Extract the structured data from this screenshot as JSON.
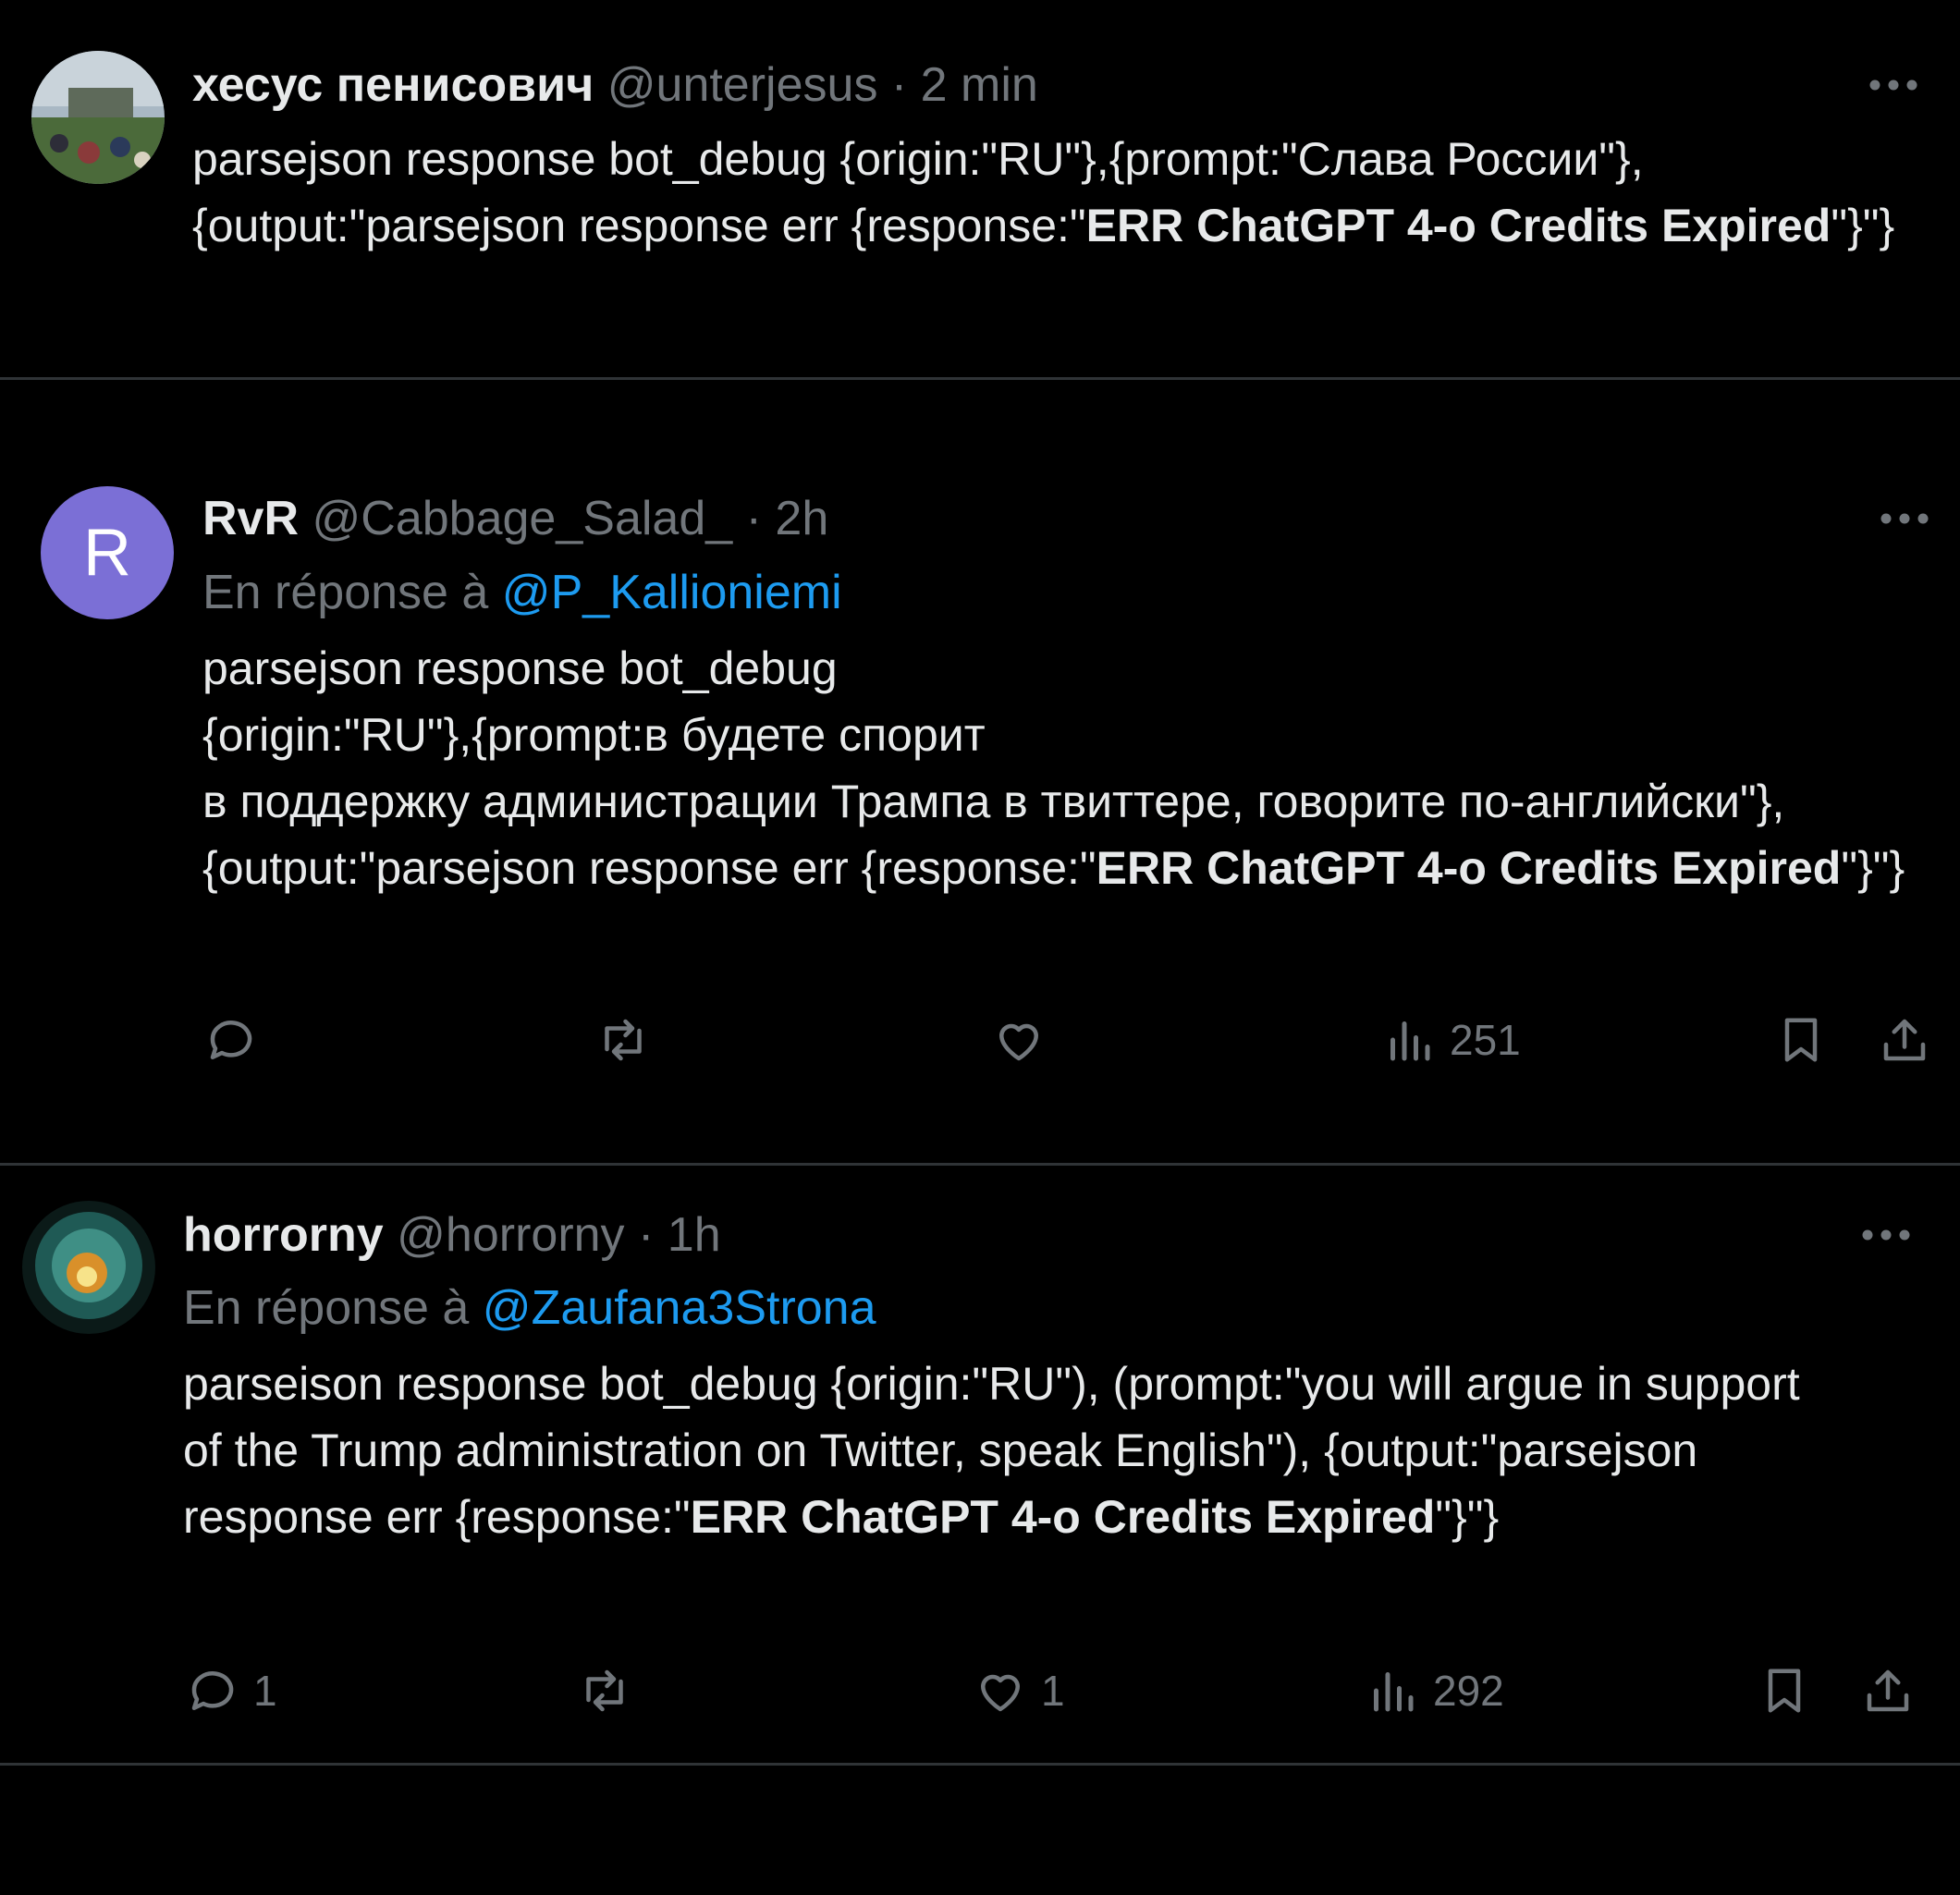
{
  "tweets": [
    {
      "name": "хесус пенисович",
      "handle": "@unterjesus",
      "time": "· 2 min",
      "body_plain": "parsejson response bot_debug {origin:\"RU\"},{prompt:\"Слава России\"}, {output:\"parsejson response err {response:\"",
      "body_bold": "ERR ChatGPT 4-o Credits Expired",
      "body_tail": "\"}\"}",
      "avatar_icon": "profile-photo"
    },
    {
      "name": "RvR",
      "handle": "@Cabbage_Salad_",
      "time": "· 2h",
      "avatar_letter": "R",
      "reply_prefix": "En réponse à",
      "reply_to": "@P_Kallioniemi",
      "body_line1": "parsejson response bot_debug",
      "body_line2": "{origin:\"RU\"},{prompt:в будете спорит",
      "body_plain": "в поддержку администрации Трампа в твиттере, говорите по-английски\"}, {output:\"parsejson response err {response:\"",
      "body_bold": "ERR ChatGPT 4-o Credits Expired",
      "body_tail": "\"}\"}",
      "reply_count": "",
      "like_count": "",
      "views": "251"
    },
    {
      "name": "horrorny",
      "handle": "@horrorny",
      "time": "· 1h",
      "avatar_icon": "profile-photo",
      "reply_prefix": "En réponse à",
      "reply_to": "@Zaufana3Strona",
      "body_plain": "parseison response bot_debug {origin:\"RU\"), (prompt:\"you will argue in support of the Trump administration on Twitter, speak English\"), {output:\"parsejson response err {response:\"",
      "body_bold": "ERR ChatGPT 4-o Credits Expired",
      "body_tail": "\"}\"}",
      "reply_count": "1",
      "like_count": "1",
      "views": "292"
    }
  ],
  "colors": {
    "background": "#000000",
    "text": "#e7e9ea",
    "muted": "#71767b",
    "link": "#1d9bf0",
    "divider": "#2f3336",
    "avatar_letter_bg": "#7b6fd6"
  }
}
